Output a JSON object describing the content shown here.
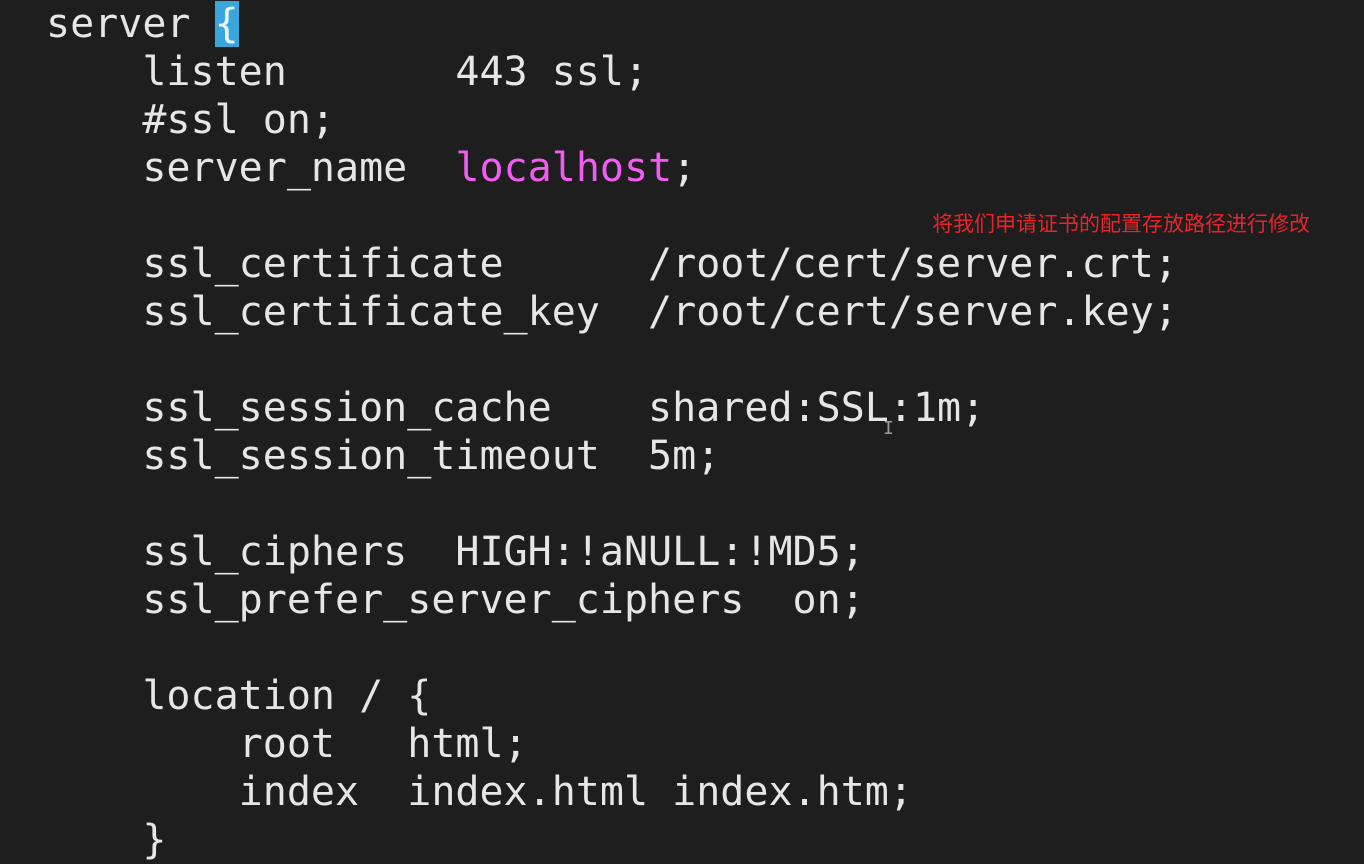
{
  "editor": {
    "lines": [
      {
        "pre": "server ",
        "hl": "",
        "cursor": "{",
        "post": ""
      },
      {
        "pre": "    listen       443 ssl;",
        "hl": "",
        "cursor": "",
        "post": ""
      },
      {
        "pre": "    #ssl on;",
        "hl": "",
        "cursor": "",
        "post": ""
      },
      {
        "pre": "    server_name  ",
        "hl": "localhost",
        "cursor": "",
        "post": ";"
      },
      {
        "pre": "",
        "hl": "",
        "cursor": "",
        "post": ""
      },
      {
        "pre": "    ssl_certificate      /root/cert/server.crt;",
        "hl": "",
        "cursor": "",
        "post": ""
      },
      {
        "pre": "    ssl_certificate_key  /root/cert/server.key;",
        "hl": "",
        "cursor": "",
        "post": ""
      },
      {
        "pre": "",
        "hl": "",
        "cursor": "",
        "post": ""
      },
      {
        "pre": "    ssl_session_cache    shared:SSL:1m;",
        "hl": "",
        "cursor": "",
        "post": ""
      },
      {
        "pre": "    ssl_session_timeout  5m;",
        "hl": "",
        "cursor": "",
        "post": ""
      },
      {
        "pre": "",
        "hl": "",
        "cursor": "",
        "post": ""
      },
      {
        "pre": "    ssl_ciphers  HIGH:!aNULL:!MD5;",
        "hl": "",
        "cursor": "",
        "post": ""
      },
      {
        "pre": "    ssl_prefer_server_ciphers  on;",
        "hl": "",
        "cursor": "",
        "post": ""
      },
      {
        "pre": "",
        "hl": "",
        "cursor": "",
        "post": ""
      },
      {
        "pre": "    location / {",
        "hl": "",
        "cursor": "",
        "post": ""
      },
      {
        "pre": "        root   html;",
        "hl": "",
        "cursor": "",
        "post": ""
      },
      {
        "pre": "        index  index.html index.htm;",
        "hl": "",
        "cursor": "",
        "post": ""
      },
      {
        "pre": "    }",
        "hl": "",
        "cursor": "",
        "post": ""
      }
    ]
  },
  "annotation": "将我们申请证书的配置存放路径进行修改",
  "colors": {
    "background": "#1e1e1e",
    "text": "#e6e6e6",
    "string": "#f25cf2",
    "cursor": "#3aa6dc",
    "annotation": "#e8232a"
  },
  "icons": {
    "mouse": "text-cursor-ibeam-icon"
  }
}
